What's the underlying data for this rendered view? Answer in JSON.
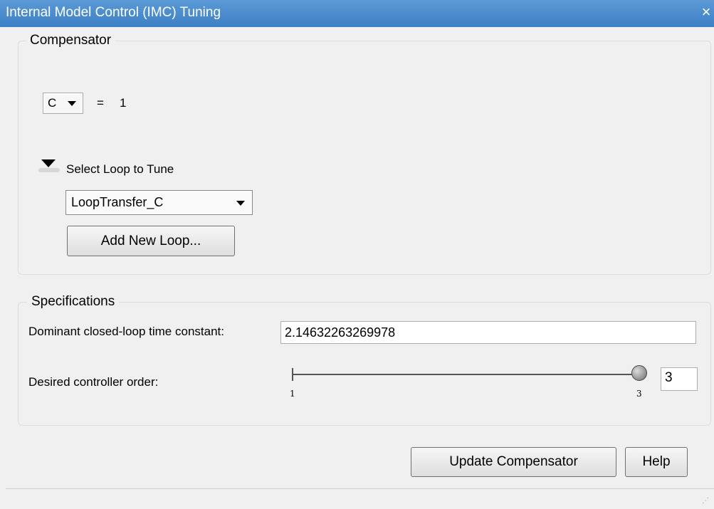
{
  "window": {
    "title": "Internal Model Control (IMC) Tuning",
    "close_glyph": "×"
  },
  "compensator": {
    "legend": "Compensator",
    "selector_value": "C",
    "equals": "=",
    "value": "1",
    "expander_label": "Select Loop to Tune",
    "loop_value": "LoopTransfer_C",
    "add_loop_label": "Add New Loop..."
  },
  "specifications": {
    "legend": "Specifications",
    "time_constant_label": "Dominant closed-loop time constant:",
    "time_constant_value": "2.14632263269978",
    "order_label": "Desired controller order:",
    "order_min": "1",
    "order_max": "3",
    "order_value": "3",
    "order_fraction": 1.0
  },
  "buttons": {
    "update": "Update Compensator",
    "help": "Help"
  },
  "colors": {
    "titlebar": "#4a8bd0"
  }
}
